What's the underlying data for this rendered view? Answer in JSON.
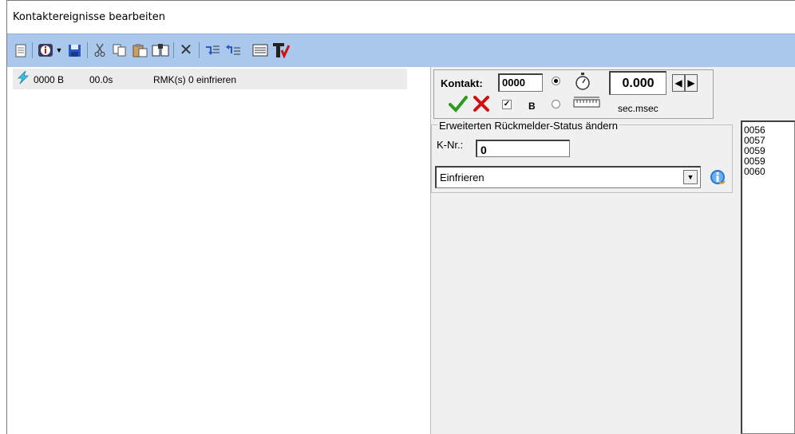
{
  "window": {
    "title": "Kontaktereignisse bearbeiten"
  },
  "toolbar": {
    "icons": [
      "new-document-icon",
      "info-icon",
      "dropdown-arrow-icon",
      "save-icon",
      "cut-icon",
      "copy-icon",
      "paste-icon",
      "find-icon",
      "delete-icon",
      "insert-before-icon",
      "insert-after-icon",
      "list-view-icon",
      "text-format-icon"
    ]
  },
  "events": [
    {
      "contact": "0000 B",
      "time": "00.0s",
      "description": "RMK(s) 0 einfrieren"
    }
  ],
  "kontakt": {
    "label": "Kontakt:",
    "value": "0000",
    "b_label": "B",
    "b_checked": true,
    "time_value": "0.000",
    "time_unit": "sec.msec",
    "mode_timer_selected": true
  },
  "status_group": {
    "legend": "Erweiterten Rückmelder-Status ändern",
    "knr_label": "K-Nr.:",
    "knr_value": "0",
    "select_value": "Einfrieren"
  },
  "number_list": [
    "0056",
    "0057",
    "0059",
    "0059",
    "0060"
  ],
  "colors": {
    "toolbar_bg": "#a9c8ec",
    "accept_green": "#2e9a1c",
    "cancel_red": "#d01010",
    "panel_bg": "#f0f0f0"
  }
}
